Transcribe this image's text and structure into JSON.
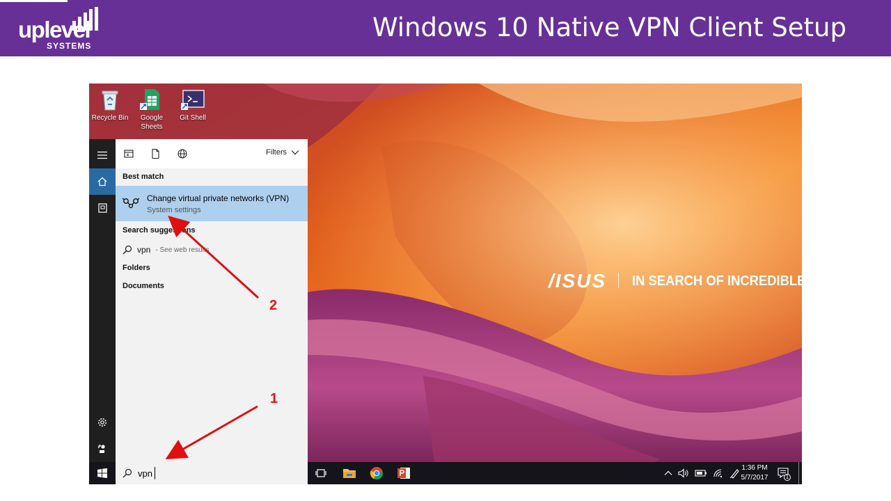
{
  "slide": {
    "title": "Windows 10 Native VPN Client Setup",
    "logo_main": "uplevel",
    "logo_sub": "SYSTEMS",
    "header_color": "#673096"
  },
  "desktop": {
    "icons": [
      {
        "label": "Recycle Bin",
        "icon": "recycle-bin-icon"
      },
      {
        "label": "Google Sheets",
        "icon": "google-sheets-icon"
      },
      {
        "label": "Git Shell",
        "icon": "git-shell-icon"
      }
    ],
    "brand": "/ISUS",
    "tagline": "IN SEARCH OF INCREDIBLE"
  },
  "start_menu": {
    "filters_label": "Filters",
    "best_match_label": "Best match",
    "best_match": {
      "title": "Change virtual private networks (VPN)",
      "subtitle": "System settings",
      "icon": "vpn-network-icon"
    },
    "suggestions_label": "Search suggestions",
    "suggestion": {
      "term": "vpn",
      "hint": "- See web results"
    },
    "folders_label": "Folders",
    "documents_label": "Documents",
    "highlight_color": "#aed0ee"
  },
  "taskbar": {
    "search_value": "vpn",
    "time": "1:36 PM",
    "date": "5/7/2017",
    "notification_count": "1",
    "apps": [
      "task-view-icon",
      "file-explorer-icon",
      "chrome-icon",
      "powerpoint-icon"
    ]
  },
  "annotations": {
    "step1": "1",
    "step2": "2",
    "arrow_color": "#e01010"
  }
}
